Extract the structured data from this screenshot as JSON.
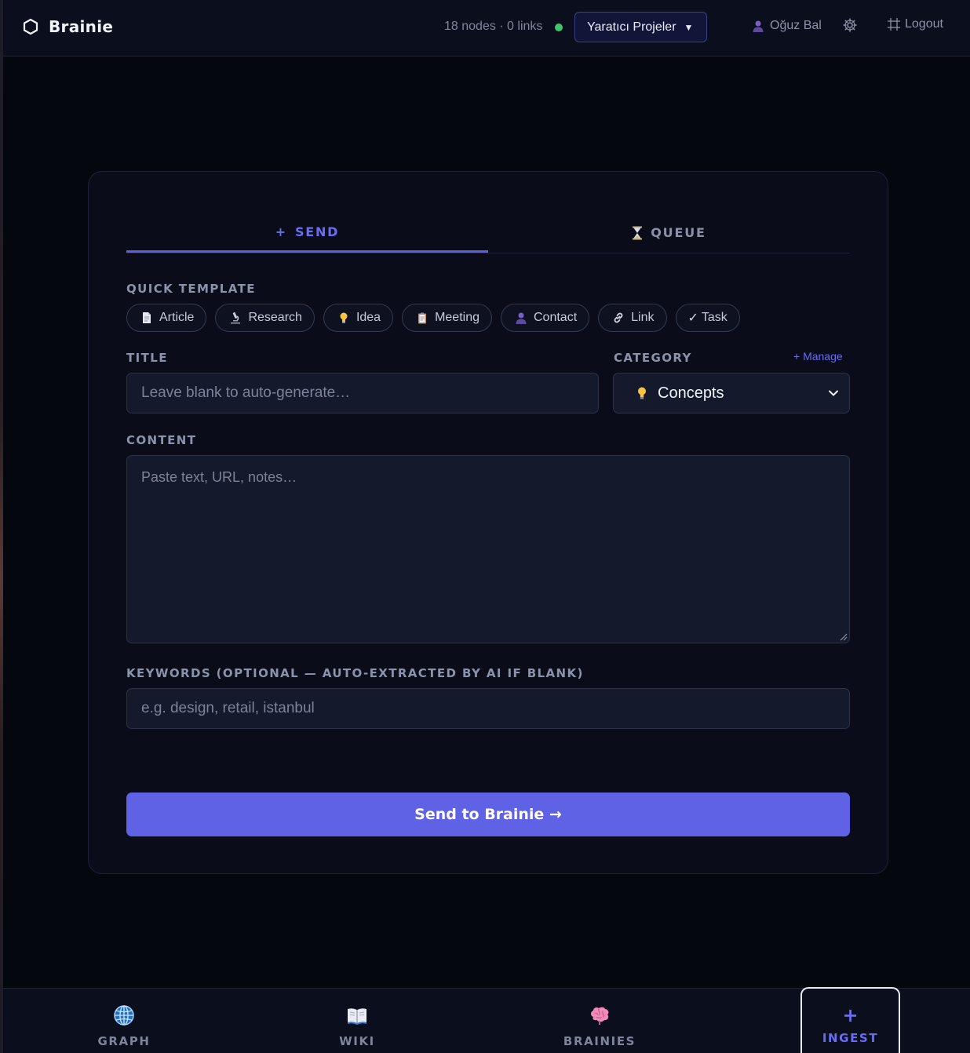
{
  "header": {
    "app_name": "Brainie",
    "stats": "18 nodes · 0 links",
    "status_color": "#3ec66b",
    "project": "Yaratıcı Projeler",
    "user_name": "Oğuz Bal",
    "logout_label": "Logout"
  },
  "tabs": [
    {
      "symbol": "+",
      "label": "SEND",
      "active": true
    },
    {
      "symbol": "⌛",
      "label": "QUEUE",
      "active": false
    }
  ],
  "form": {
    "quick_template_label": "QUICK TEMPLATE",
    "templates": [
      {
        "icon": "document-icon",
        "label": "Article"
      },
      {
        "icon": "microscope-icon",
        "label": "Research"
      },
      {
        "icon": "lightbulb-icon",
        "label": "Idea"
      },
      {
        "icon": "clipboard-icon",
        "label": "Meeting"
      },
      {
        "icon": "person-icon",
        "label": "Contact"
      },
      {
        "icon": "link-icon",
        "label": "Link"
      },
      {
        "icon": "check-icon",
        "label": "Task"
      }
    ],
    "title_label": "TITLE",
    "title_placeholder": "Leave blank to auto-generate…",
    "category_label": "CATEGORY",
    "manage_label": "+ Manage",
    "category_value": "Concepts",
    "content_label": "CONTENT",
    "content_placeholder": "Paste text, URL, notes…",
    "keywords_label": "KEYWORDS (OPTIONAL — AUTO-EXTRACTED BY AI IF BLANK)",
    "keywords_placeholder": "e.g. design, retail, istanbul",
    "submit_label": "Send to Brainie →"
  },
  "bottom_nav": [
    {
      "icon": "globe-icon",
      "label": "GRAPH"
    },
    {
      "icon": "book-icon",
      "label": "WIKI"
    },
    {
      "icon": "brain-icon",
      "label": "BRAINIES"
    },
    {
      "icon": "plus-icon",
      "label": "INGEST",
      "active": true
    }
  ],
  "colors": {
    "accent": "#6062e6",
    "background": "#05070e",
    "card": "#0a0d19"
  }
}
